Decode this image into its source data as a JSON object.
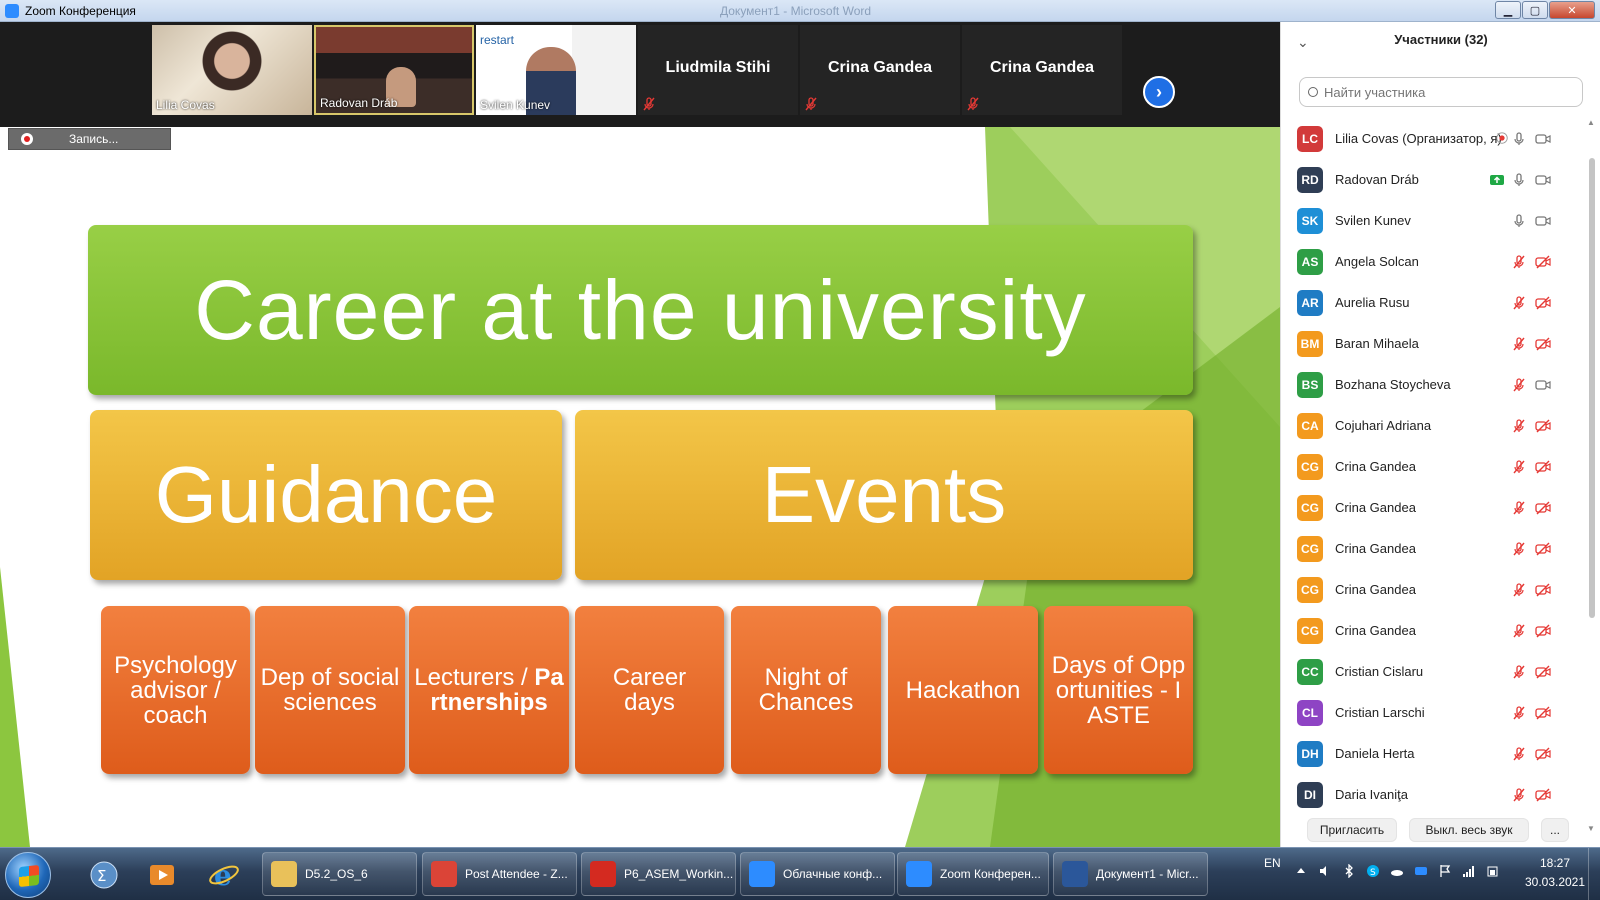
{
  "window": {
    "title": "Zoom Конференция",
    "ghost_title": "Документ1 - Microsoft Word"
  },
  "video_strip": {
    "tiles": [
      {
        "name": "Lilia Covas",
        "type": "video"
      },
      {
        "name": "Radovan Dráb",
        "type": "video"
      },
      {
        "name": "Svilen Kunev",
        "type": "video",
        "slide_brand": "restart"
      },
      {
        "name": "Liudmila Stihi",
        "type": "name",
        "muted": true
      },
      {
        "name": "Crina Gandea",
        "type": "name",
        "muted": true
      },
      {
        "name": "Crina Gandea",
        "type": "name",
        "muted": true
      }
    ],
    "next_icon": "chevron-right-icon"
  },
  "recording": {
    "label": "Запись..."
  },
  "slide": {
    "title": "Career at the university",
    "guidance": "Guidance",
    "events": "Events",
    "items": [
      {
        "text": "Psychology advisor / coach"
      },
      {
        "text": "Dep of social sciences"
      },
      {
        "text": "Lecturers / ",
        "bold": "Partnerships"
      },
      {
        "text": "Career days"
      },
      {
        "text": "Night of Chances"
      },
      {
        "text": "Hackathon"
      },
      {
        "text": "Days of Opportunities - IASTE"
      }
    ],
    "colors": {
      "green": "#8cc63f",
      "gold": "#edb33a",
      "orange": "#e96b2c"
    }
  },
  "participants": {
    "header": "Участники (32)",
    "search_placeholder": "Найти участника",
    "list": [
      {
        "initials": "LC",
        "name": "Lilia Covas (Организатор, я)",
        "color": "#d23a3a",
        "mic": "on",
        "video": "on",
        "rec": true
      },
      {
        "initials": "RD",
        "name": "Radovan Dráb",
        "color": "#2f3e55",
        "mic": "on",
        "video": "on",
        "share": true
      },
      {
        "initials": "SK",
        "name": "Svilen Kunev",
        "color": "#1e8fd6",
        "mic": "on",
        "video": "on"
      },
      {
        "initials": "AS",
        "name": "Angela Solcan",
        "color": "#2e9e46",
        "mic": "off",
        "video": "off"
      },
      {
        "initials": "AR",
        "name": "Aurelia Rusu",
        "color": "#1f7cc4",
        "mic": "off",
        "video": "off"
      },
      {
        "initials": "BM",
        "name": "Baran Mihaela",
        "color": "#f39a1e",
        "mic": "off",
        "video": "off"
      },
      {
        "initials": "BS",
        "name": "Bozhana Stoycheva",
        "color": "#2e9e46",
        "mic": "off",
        "video": "on"
      },
      {
        "initials": "CA",
        "name": "Cojuhari Adriana",
        "color": "#f39a1e",
        "mic": "off",
        "video": "off"
      },
      {
        "initials": "CG",
        "name": "Crina Gandea",
        "color": "#f39a1e",
        "mic": "off",
        "video": "off"
      },
      {
        "initials": "CG",
        "name": "Crina Gandea",
        "color": "#f39a1e",
        "mic": "off",
        "video": "off"
      },
      {
        "initials": "CG",
        "name": "Crina Gandea",
        "color": "#f39a1e",
        "mic": "off",
        "video": "off"
      },
      {
        "initials": "CG",
        "name": "Crina Gandea",
        "color": "#f39a1e",
        "mic": "off",
        "video": "off"
      },
      {
        "initials": "CG",
        "name": "Crina Gandea",
        "color": "#f39a1e",
        "mic": "off",
        "video": "off"
      },
      {
        "initials": "CC",
        "name": "Cristian Cislaru",
        "color": "#2e9e46",
        "mic": "off",
        "video": "off"
      },
      {
        "initials": "CL",
        "name": "Cristian Larschi",
        "color": "#8e44c4",
        "mic": "off",
        "video": "off"
      },
      {
        "initials": "DH",
        "name": "Daniela Herta",
        "color": "#1f7cc4",
        "mic": "off",
        "video": "off"
      },
      {
        "initials": "DI",
        "name": "Daria Ivaniţa",
        "color": "#2f3e55",
        "mic": "off",
        "video": "off"
      }
    ],
    "footer": {
      "invite": "Пригласить",
      "mute_all": "Выкл. весь звук",
      "more": "..."
    }
  },
  "taskbar": {
    "buttons": [
      {
        "label": "D5.2_OS_6",
        "icon": "folder-icon",
        "color": "#e9c15a"
      },
      {
        "label": "Post Attendee - Z...",
        "icon": "chrome-icon",
        "color": "#db4437"
      },
      {
        "label": "P6_ASEM_Workin...",
        "icon": "pdf-icon",
        "color": "#d42a20"
      },
      {
        "label": "Облачные конф...",
        "icon": "zoom-icon",
        "color": "#2d8cff"
      },
      {
        "label": "Zoom Конферен...",
        "icon": "zoom-icon",
        "color": "#2d8cff"
      },
      {
        "label": "Документ1 - Micr...",
        "icon": "word-icon",
        "color": "#2b579a"
      }
    ],
    "lang": "EN",
    "time": "18:27",
    "date": "30.03.2021"
  }
}
